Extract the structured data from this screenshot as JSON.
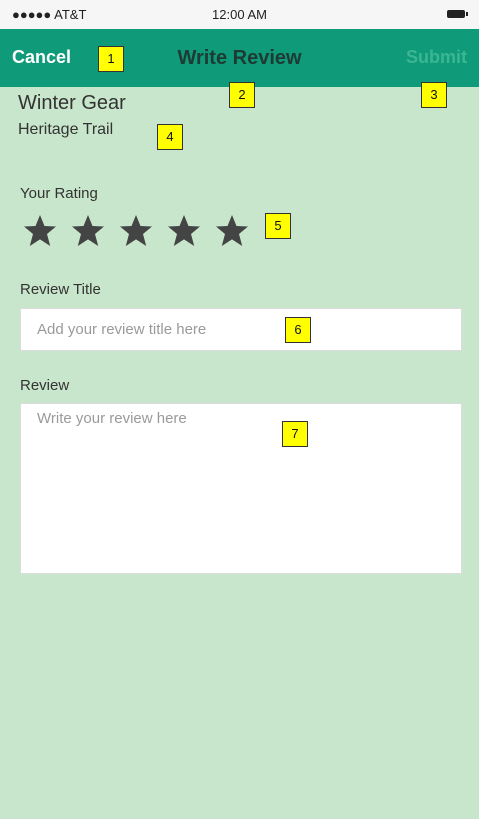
{
  "status_bar": {
    "carrier": "●●●●● AT&T",
    "time": "12:00 AM"
  },
  "nav": {
    "cancel": "Cancel",
    "title": "Write Review",
    "submit": "Submit"
  },
  "product": {
    "name": "Winter Gear",
    "subtitle": "Heritage Trail"
  },
  "rating": {
    "label": "Your Rating",
    "stars": 5,
    "filled": 0,
    "star_color": "#444444"
  },
  "review_title": {
    "label": "Review Title",
    "placeholder": "Add your review title here",
    "value": ""
  },
  "review": {
    "label": "Review",
    "placeholder": "Write your review here",
    "value": ""
  },
  "annotations": [
    "1",
    "2",
    "3",
    "4",
    "5",
    "6",
    "7"
  ],
  "colors": {
    "background": "#c8e6cb",
    "nav": "#0f9a7a",
    "badge": "#ffff00"
  }
}
